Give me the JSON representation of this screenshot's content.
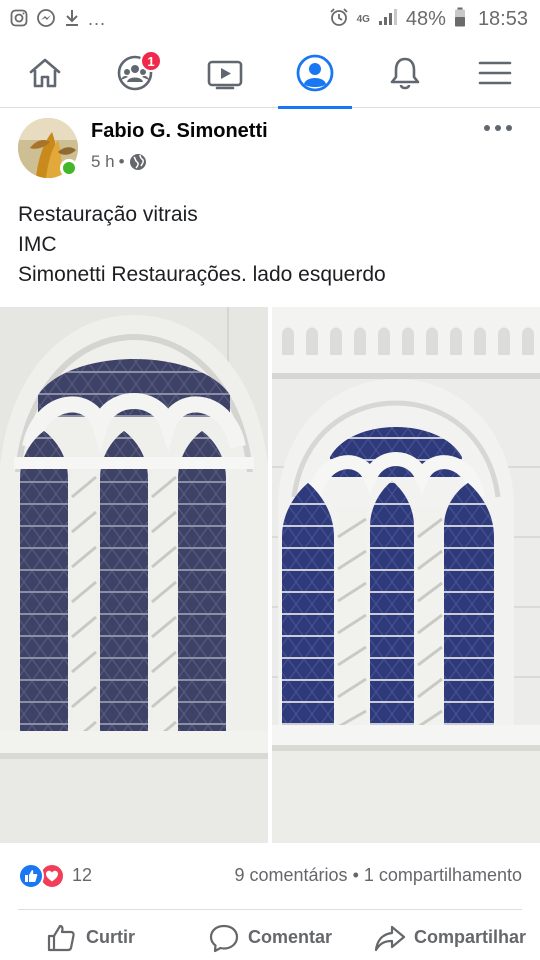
{
  "status_bar": {
    "left_icons": [
      "instagram-icon",
      "messenger-icon",
      "download-icon"
    ],
    "more_indicator": "...",
    "network_label": "4G",
    "battery_percent": "48%",
    "time": "18:53"
  },
  "nav": {
    "items": [
      {
        "name": "home",
        "icon": "home-icon",
        "active": false
      },
      {
        "name": "groups",
        "icon": "groups-icon",
        "active": false,
        "badge": "1"
      },
      {
        "name": "watch",
        "icon": "video-icon",
        "active": false
      },
      {
        "name": "profile",
        "icon": "profile-icon",
        "active": true
      },
      {
        "name": "notifications",
        "icon": "bell-icon",
        "active": false
      },
      {
        "name": "menu",
        "icon": "hamburger-icon",
        "active": false
      }
    ],
    "accent_color": "#1877f2",
    "badge_color": "#f02849"
  },
  "post": {
    "author": "Fabio G. Simonetti",
    "time": "5 h",
    "separator": "•",
    "privacy_icon": "globe-icon",
    "text_lines": [
      "Restauração vitrais",
      "IMC",
      "Simonetti Restaurações. lado esquerdo"
    ]
  },
  "reactions": {
    "count": "12",
    "comments": "9 comentários",
    "separator": "•",
    "shares": "1 compartilhamento"
  },
  "actions": {
    "like": "Curtir",
    "comment": "Comentar",
    "share": "Compartilhar"
  }
}
